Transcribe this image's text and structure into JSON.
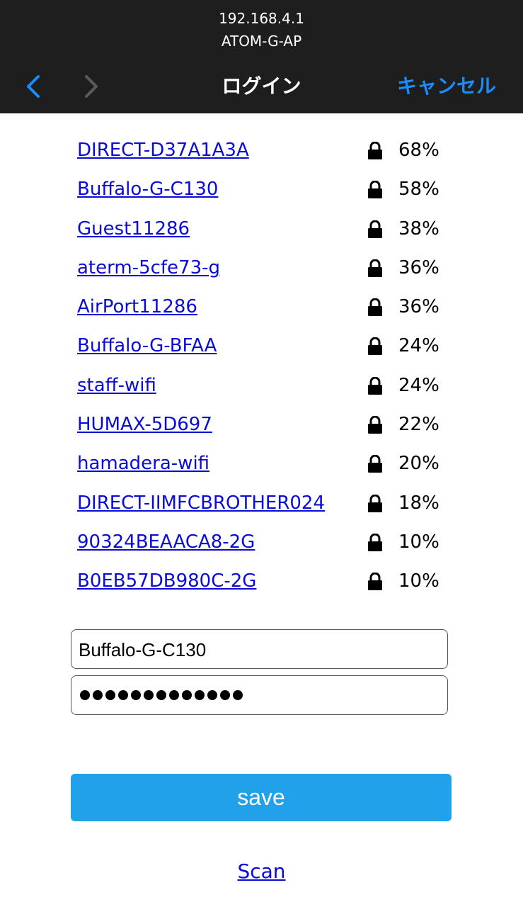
{
  "browser": {
    "url": "192.168.4.1",
    "host": "ATOM-G-AP",
    "title": "ログイン",
    "cancel_label": "キャンセル"
  },
  "networks": [
    {
      "ssid": "DIRECT-D37A1A3A",
      "signal": "68%",
      "icon": "lock-icon"
    },
    {
      "ssid": "Buffalo-G-C130",
      "signal": "58%",
      "icon": "lock-icon"
    },
    {
      "ssid": "Guest11286",
      "signal": "38%",
      "icon": "lock-icon"
    },
    {
      "ssid": "aterm-5cfe73-g",
      "signal": "36%",
      "icon": "lock-icon"
    },
    {
      "ssid": "AirPort11286",
      "signal": "36%",
      "icon": "lock-icon"
    },
    {
      "ssid": "Buffalo-G-BFAA",
      "signal": "24%",
      "icon": "lock-icon"
    },
    {
      "ssid": "staff-wifi",
      "signal": "24%",
      "icon": "lock-icon"
    },
    {
      "ssid": "HUMAX-5D697",
      "signal": "22%",
      "icon": "lock-icon"
    },
    {
      "ssid": "hamadera-wifi",
      "signal": "20%",
      "icon": "lock-icon"
    },
    {
      "ssid": "DIRECT-IIMFCBROTHER024",
      "signal": "18%",
      "icon": "lock-icon"
    },
    {
      "ssid": "90324BEAACA8-2G",
      "signal": "10%",
      "icon": "lock-icon"
    },
    {
      "ssid": "B0EB57DB980C-2G",
      "signal": "10%",
      "icon": "lock-icon"
    }
  ],
  "form": {
    "ssid_value": "Buffalo-G-C130",
    "password_length": 13,
    "save_label": "save",
    "scan_label": "Scan"
  },
  "colors": {
    "topbar": "#1e1e1e",
    "accent": "#1a8cff",
    "link": "#0b0bd6",
    "button": "#21a1ea"
  }
}
